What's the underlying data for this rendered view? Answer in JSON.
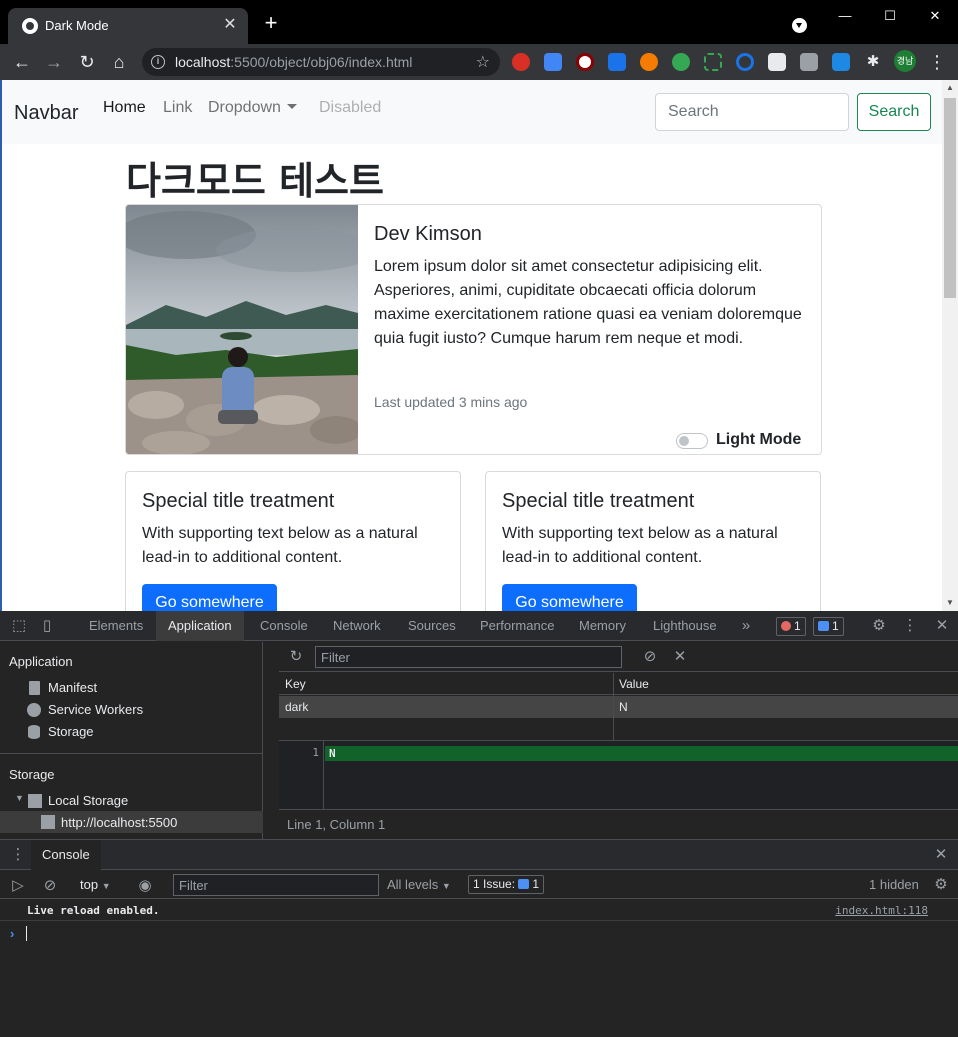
{
  "browser": {
    "tab_title": "Dark Mode",
    "url_host": "localhost",
    "url_rest": ":5500/object/obj06/index.html",
    "avatar_text": "경남"
  },
  "navbar": {
    "brand": "Navbar",
    "links": [
      "Home",
      "Link",
      "Dropdown",
      "Disabled"
    ],
    "search_placeholder": "Search",
    "search_button": "Search"
  },
  "page": {
    "title": "다크모드 테스트",
    "profile_card": {
      "title": "Dev Kimson",
      "text": "Lorem ipsum dolor sit amet consectetur adipisicing elit. Asperiores, animi, cupiditate obcaecati officia dolorum maxime exercitationem ratione quasi ea veniam doloremque quia fugit iusto? Cumque harum rem neque et modi.",
      "updated": "Last updated 3 mins ago",
      "toggle_label": "Light Mode"
    },
    "cards": [
      {
        "title": "Special title treatment",
        "text": "With supporting text below as a natural lead-in to additional content.",
        "button": "Go somewhere"
      },
      {
        "title": "Special title treatment",
        "text": "With supporting text below as a natural lead-in to additional content.",
        "button": "Go somewhere"
      }
    ]
  },
  "devtools": {
    "tabs": [
      "Elements",
      "Application",
      "Console",
      "Network",
      "Sources",
      "Performance",
      "Memory",
      "Lighthouse"
    ],
    "error_count": "1",
    "message_count": "1",
    "sidebar": {
      "application_heading": "Application",
      "application_items": [
        "Manifest",
        "Service Workers",
        "Storage"
      ],
      "storage_heading": "Storage",
      "local_storage": "Local Storage",
      "origin": "http://localhost:5500"
    },
    "filter_placeholder": "Filter",
    "table": {
      "headers": [
        "Key",
        "Value"
      ],
      "rows": [
        {
          "key": "dark",
          "value": "N"
        }
      ]
    },
    "preview": {
      "line_number": "1",
      "content": "N"
    },
    "status": "Line 1, Column 1",
    "drawer": {
      "tab": "Console",
      "context": "top",
      "filter_placeholder": "Filter",
      "levels": "All levels",
      "issues_label": "1 Issue:",
      "issues_count": "1",
      "hidden": "1 hidden",
      "message": "Live reload enabled.",
      "message_source": "index.html:118"
    }
  }
}
